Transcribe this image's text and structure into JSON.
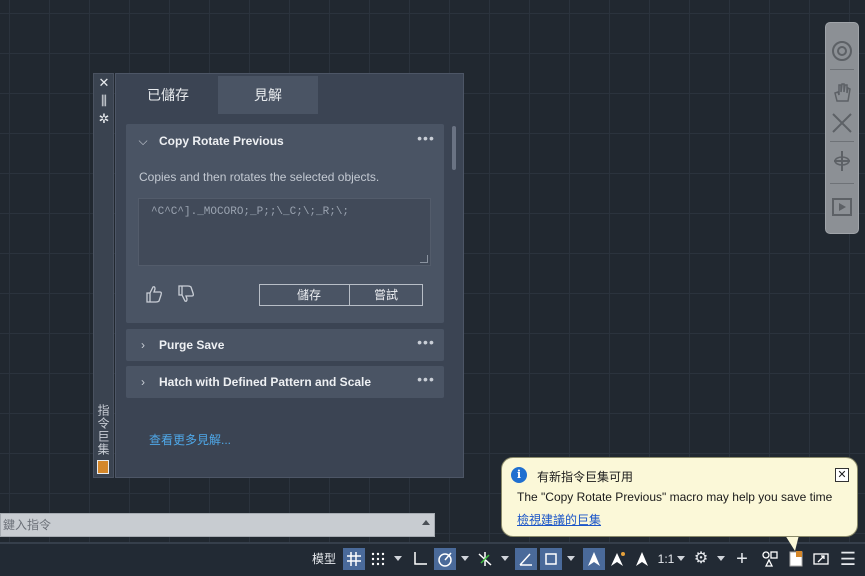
{
  "palette": {
    "title": "指令巨集",
    "tabs": [
      {
        "label": "已儲存"
      },
      {
        "label": "見解"
      }
    ],
    "cards": [
      {
        "title": "Copy Rotate Previous",
        "description": "Copies and then rotates the selected objects.",
        "macro": "^C^C^]._MOCORO;_P;;\\_C;\\;_R;\\;",
        "save_label": "儲存",
        "try_label": "嘗試",
        "expanded": true
      },
      {
        "title": "Purge Save",
        "expanded": false
      },
      {
        "title": "Hatch with Defined Pattern and Scale",
        "expanded": false
      }
    ],
    "more_link": "查看更多見解..."
  },
  "command_line": {
    "placeholder": "鍵入指令"
  },
  "status_bar": {
    "model_label": "模型",
    "scale_label": "1:1"
  },
  "notification": {
    "title": "有新指令巨集可用",
    "message": "The \"Copy Rotate Previous\" macro may help you save time",
    "link": "檢視建議的巨集"
  },
  "colors": {
    "accent": "#4a6a9a",
    "link": "#4fa8e8",
    "background": "#212830"
  }
}
